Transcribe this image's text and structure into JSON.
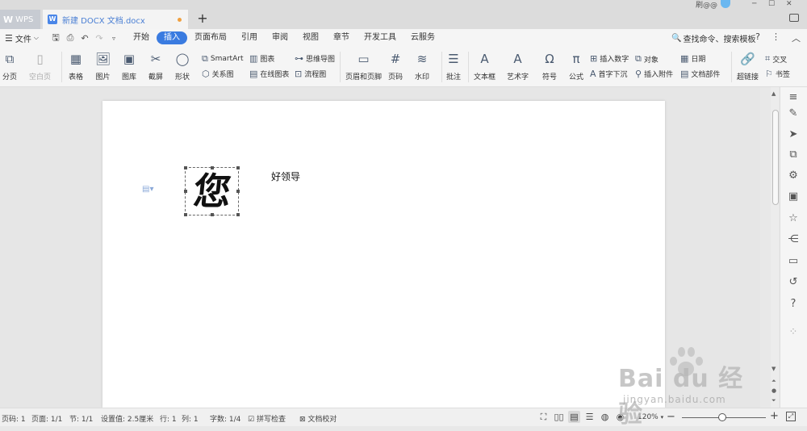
{
  "titlebar": {
    "app_tab": {
      "logo": "W",
      "label": "WPS"
    },
    "doc_tab": {
      "icon": "W",
      "title": "新建 DOCX 文档.docx"
    },
    "new_tab": "+",
    "user": "刷@@"
  },
  "menubar": {
    "file_label": "文件",
    "tabs": [
      "开始",
      "插入",
      "页面布局",
      "引用",
      "审阅",
      "视图",
      "章节",
      "开发工具",
      "云服务"
    ],
    "active_tab": "插入",
    "search": "查找命令、搜索模板",
    "help": "?"
  },
  "ribbon": {
    "page_break": "分页",
    "blank_page": "空白页",
    "table": "表格",
    "picture": "图片",
    "gallery": "图库",
    "screenshot": "截屏",
    "shapes": "形状",
    "smartart": "SmartArt",
    "chart": "图表",
    "relation": "关系图",
    "online_chart": "在线图表",
    "mindmap": "思维导图",
    "flowchart": "流程图",
    "header_footer": "页眉和页脚",
    "page_number": "页码",
    "watermark": "水印",
    "comment": "批注",
    "textbox": "文本框",
    "wordart": "艺术字",
    "symbol": "符号",
    "formula": "公式",
    "insert_number": "插入数字",
    "object": "对象",
    "date": "日期",
    "drop_cap": "首字下沉",
    "attachment": "插入附件",
    "doc_parts": "文档部件",
    "hyperlink": "超链接",
    "cross_ref": "交叉",
    "bookmark": "书签"
  },
  "document": {
    "image_char": "您",
    "text": "好领导"
  },
  "statusbar": {
    "page_code": "页码: 1",
    "page": "页面: 1/1",
    "section": "节: 1/1",
    "position": "设置值: 2.5厘米",
    "row": "行: 1",
    "col": "列: 1",
    "word_count": "字数: 1/4",
    "spell_check": "拼写检查",
    "doc_proof": "文档校对",
    "zoom": "120%",
    "zoom_fraction": 0.48
  },
  "watermark": {
    "main": "Bai du 经验",
    "sub": "jingyan.baidu.com"
  }
}
